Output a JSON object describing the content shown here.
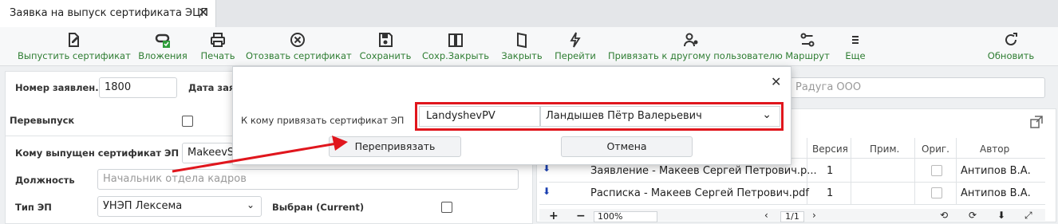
{
  "tab": {
    "title": "Заявка на выпуск сертификата ЭЦП"
  },
  "toolbar": {
    "items": [
      {
        "label": "Выпустить сертификат",
        "icon": "issue-certificate-icon"
      },
      {
        "label": "Вложения",
        "icon": "attachments-icon"
      },
      {
        "label": "Печать",
        "icon": "printer-icon"
      },
      {
        "label": "Отозвать сертификат",
        "icon": "revoke-icon"
      },
      {
        "label": "Сохранить",
        "icon": "save-icon"
      },
      {
        "label": "Сохр.Закрыть",
        "icon": "save-close-icon"
      },
      {
        "label": "Закрыть",
        "icon": "close-doc-icon"
      },
      {
        "label": "Перейти",
        "icon": "navigate-icon"
      },
      {
        "label": "Привязать к другому пользователю",
        "icon": "rebind-user-icon"
      },
      {
        "label": "Маршрут",
        "icon": "route-icon"
      },
      {
        "label": "Еще",
        "icon": "more-icon"
      },
      {
        "label": "Обновить",
        "icon": "refresh-icon"
      }
    ]
  },
  "form": {
    "number_label": "Номер заявлен...",
    "number_value": "1800",
    "date_label": "Дата заявк",
    "org_placeholder": "Радуга ООО",
    "reissue_label": "Перевыпуск",
    "issued_to_label": "Кому выпущен сертификат ЭП",
    "issued_to_value": "MakeevSl",
    "position_label": "Должность",
    "position_placeholder": "Начальник отдела кадров",
    "ep_type_label": "Тип ЭП",
    "ep_type_value": "УНЭП Лексема",
    "selected_label": "Выбран (Current)"
  },
  "files": {
    "columns": [
      "Версия",
      "Прим.",
      "Ориг.",
      "Автор"
    ],
    "rows": [
      {
        "name": "Заявление - Макеев Сергей Петрович.p...",
        "version": "1",
        "author": "Антипов В.А."
      },
      {
        "name": "Расписка - Макеев Сергей Петрович.pdf",
        "version": "1",
        "author": "Антипов В.А."
      }
    ],
    "zoom": "100%",
    "page": "1/1"
  },
  "dialog": {
    "label": "К кому привязать сертификат ЭП",
    "login_value": "LandyshevPV",
    "fullname_value": "Ландышев Пётр Валерьевич",
    "rebind_button": "Перепривязать",
    "cancel_button": "Отмена"
  },
  "colors": {
    "accent_green": "#2e7d32",
    "highlight_red": "#e0161d"
  }
}
